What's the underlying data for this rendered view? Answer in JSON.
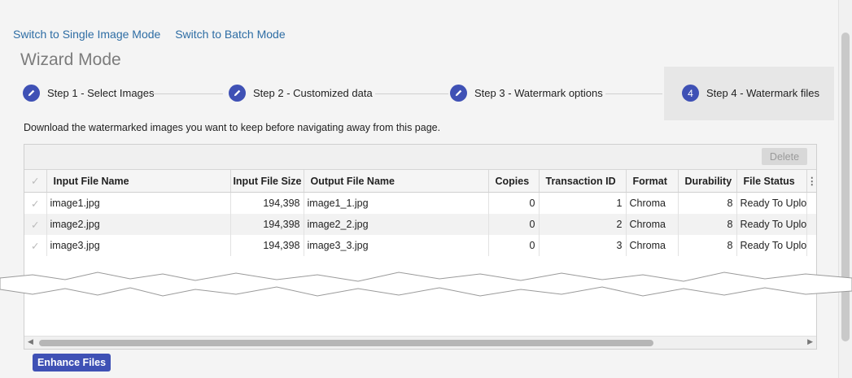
{
  "mode_links": {
    "single": "Switch to Single Image Mode",
    "batch": "Switch to Batch Mode"
  },
  "page_title": "Wizard Mode",
  "steps": [
    {
      "num": "",
      "label": "Step 1 - Select Images",
      "state": "done"
    },
    {
      "num": "",
      "label": "Step 2 - Customized data",
      "state": "done"
    },
    {
      "num": "",
      "label": "Step 3 - Watermark options",
      "state": "done"
    },
    {
      "num": "4",
      "label": "Step 4 - Watermark files",
      "state": "active"
    }
  ],
  "note": "Download the watermarked images you want to keep before navigating away from this page.",
  "grid": {
    "delete_label": "Delete",
    "columns": [
      "Input File Name",
      "Input File Size",
      "Output File Name",
      "Copies",
      "Transaction ID",
      "Format",
      "Durability",
      "File Status"
    ],
    "rows": [
      [
        "image1.jpg",
        "194,398",
        "image1_1.jpg",
        "0",
        "1",
        "Chroma",
        "8",
        "Ready To Uplo"
      ],
      [
        "image2.jpg",
        "194,398",
        "image2_2.jpg",
        "0",
        "2",
        "Chroma",
        "8",
        "Ready To Uplo"
      ],
      [
        "image3.jpg",
        "194,398",
        "image3_3.jpg",
        "0",
        "3",
        "Chroma",
        "8",
        "Ready To Uplo"
      ]
    ]
  },
  "enhance_label": "Enhance Files",
  "colors": {
    "accent": "#3f51b5",
    "link": "#2e6da4"
  }
}
